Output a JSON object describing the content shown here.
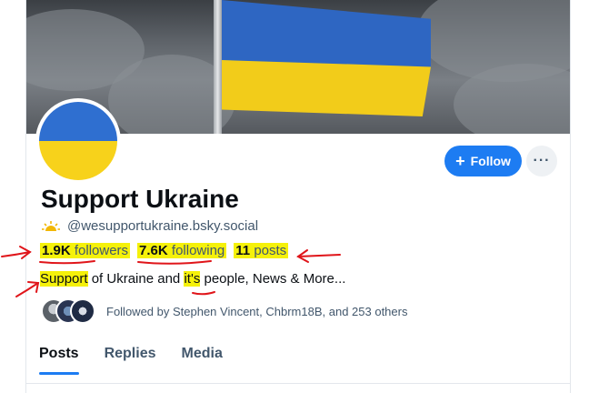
{
  "profile": {
    "display_name": "Support Ukraine",
    "handle": "@wesupportukraine.bsky.social",
    "handle_icon": "sun-icon",
    "stats": {
      "followers_count": "1.9K",
      "followers_label": "followers",
      "following_count": "7.6K",
      "following_label": "following",
      "posts_count": "11",
      "posts_label": "posts"
    },
    "bio": {
      "part1": "Support",
      "part2": " of Ukraine and ",
      "part3": "it's",
      "part4": " people, News & More..."
    },
    "followed_by": "Followed by Stephen Vincent, Chbrm18B, and 253 others"
  },
  "actions": {
    "follow_label": "Follow",
    "follow_icon": "plus-icon",
    "more_label": "···"
  },
  "tabs": [
    {
      "label": "Posts",
      "active": true
    },
    {
      "label": "Replies",
      "active": false
    },
    {
      "label": "Media",
      "active": false
    }
  ],
  "colors": {
    "accent": "#1d7cf2",
    "highlight": "#f5f10a",
    "annotation": "#e0151a",
    "flag_blue": "#2f6fd0",
    "flag_yellow": "#f7d21b"
  }
}
